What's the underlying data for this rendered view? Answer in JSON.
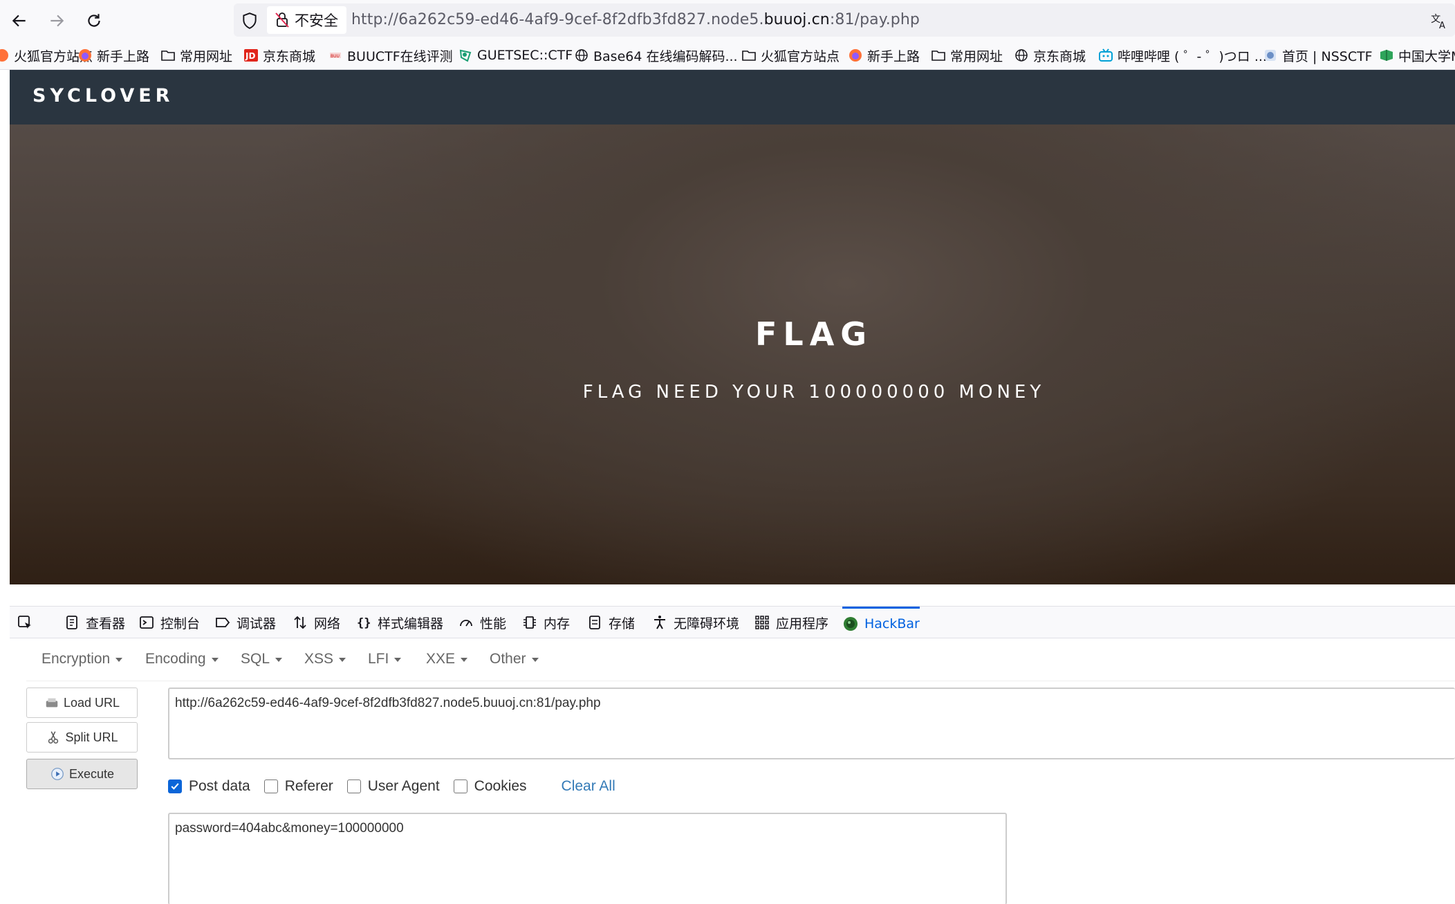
{
  "browser": {
    "insecure_label": "不安全",
    "url_prefix": "http://6a262c59-ed46-4af9-9cef-8f2dfb3fd827.node5.",
    "url_domain": "buuoj.cn",
    "url_suffix": ":81/pay.php"
  },
  "bookmarks": [
    {
      "label": "火狐官方站点",
      "icon": "firefox-cut-icon"
    },
    {
      "label": "新手上路",
      "icon": "firefox-icon"
    },
    {
      "label": "常用网址",
      "icon": "folder-icon"
    },
    {
      "label": "京东商城",
      "icon": "jd-icon"
    },
    {
      "label": "BUUCTF在线评测",
      "icon": "buuctf-icon"
    },
    {
      "label": "GUETSEC::CTF",
      "icon": "guetsec-icon"
    },
    {
      "label": "Base64 在线编码解码...",
      "icon": "globe-icon"
    },
    {
      "label": "火狐官方站点",
      "icon": "folder-icon"
    },
    {
      "label": "新手上路",
      "icon": "firefox-icon"
    },
    {
      "label": "常用网址",
      "icon": "folder-icon"
    },
    {
      "label": "京东商城",
      "icon": "globe-icon"
    },
    {
      "label": "哔哩哔哩 ( ゜- ゜)つロ ...",
      "icon": "bilibili-icon"
    },
    {
      "label": "首页 | NSSCTF",
      "icon": "nssctf-icon"
    },
    {
      "label": "中国大学M",
      "icon": "mooc-icon"
    }
  ],
  "site": {
    "logo": "SYCLOVER",
    "hero_title": "FLAG",
    "hero_subtitle": "FLAG NEED YOUR 100000000 MONEY"
  },
  "devtools": {
    "tabs": [
      {
        "label": "查看器",
        "icon": "inspector-icon"
      },
      {
        "label": "控制台",
        "icon": "console-icon"
      },
      {
        "label": "调试器",
        "icon": "debugger-icon"
      },
      {
        "label": "网络",
        "icon": "network-icon"
      },
      {
        "label": "样式编辑器",
        "icon": "style-editor-icon"
      },
      {
        "label": "性能",
        "icon": "performance-icon"
      },
      {
        "label": "内存",
        "icon": "memory-icon"
      },
      {
        "label": "存储",
        "icon": "storage-icon"
      },
      {
        "label": "无障碍环境",
        "icon": "accessibility-icon"
      },
      {
        "label": "应用程序",
        "icon": "application-icon"
      },
      {
        "label": "HackBar",
        "icon": "hackbar-icon"
      }
    ],
    "active_tab": "HackBar"
  },
  "hackbar": {
    "menu": [
      "Encryption",
      "Encoding",
      "SQL",
      "XSS",
      "LFI",
      "XXE",
      "Other"
    ],
    "load_url": "Load URL",
    "split_url": "Split URL",
    "execute": "Execute",
    "url_value": "http://6a262c59-ed46-4af9-9cef-8f2dfb3fd827.node5.buuoj.cn:81/pay.php",
    "checks": [
      {
        "label": "Post data",
        "checked": true
      },
      {
        "label": "Referer",
        "checked": false
      },
      {
        "label": "User Agent",
        "checked": false
      },
      {
        "label": "Cookies",
        "checked": false
      }
    ],
    "clear_all": "Clear All",
    "post_value": "password=404abc&money=100000000"
  },
  "colors": {
    "header_bg": "#2a3540",
    "accent": "#0061e0",
    "checkbox": "#0b65d8",
    "link": "#337ab7"
  }
}
